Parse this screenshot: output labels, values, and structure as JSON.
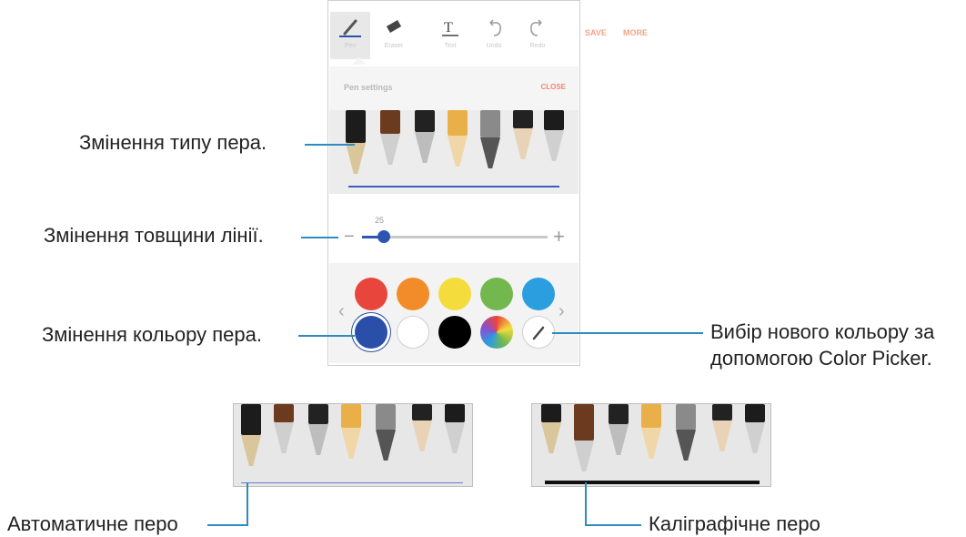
{
  "toolbar": {
    "tools": [
      {
        "label": "Pen",
        "icon": "brush-icon"
      },
      {
        "label": "Eraser",
        "icon": "eraser-icon"
      },
      {
        "label": "Text",
        "icon": "text-icon"
      },
      {
        "label": "Undo",
        "icon": "undo-icon"
      },
      {
        "label": "Redo",
        "icon": "redo-icon"
      }
    ],
    "save_label": "SAVE",
    "more_label": "MORE"
  },
  "pen_settings": {
    "title": "Pen settings",
    "close_label": "CLOSE",
    "thickness_value": "25",
    "thickness_fraction": 0.1
  },
  "palette": {
    "row1": [
      "#e8463c",
      "#f28c28",
      "#f4dc3c",
      "#73b84e",
      "#2b9ee0"
    ],
    "row2": [
      "#2a4fa8",
      "#ffffff",
      "#000000",
      "color-wheel",
      "eyedropper-icon"
    ],
    "selected": "#2a4fa8"
  },
  "callouts": {
    "pen_type": "Змінення типу пера.",
    "line_thickness": "Змінення товщини лінії.",
    "pen_color": "Змінення кольору пера.",
    "color_picker_line1": "Вибір нового кольору за",
    "color_picker_line2": "допомогою Color Picker.",
    "auto_pen": "Автоматичне перо",
    "calligraphy_pen": "Каліграфічне перо"
  },
  "colors": {
    "accent": "#2d8bc2",
    "selection": "#2a51a8"
  }
}
